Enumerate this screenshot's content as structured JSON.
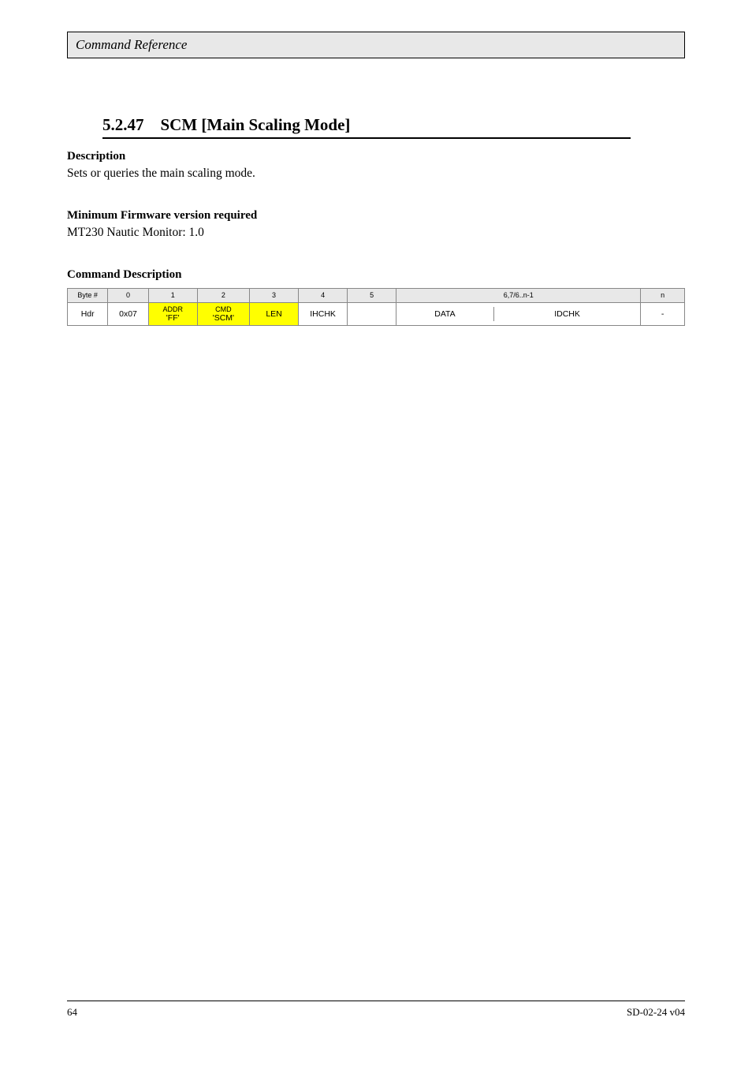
{
  "header": {
    "title": "Command Reference"
  },
  "section": {
    "number": "5.2.47",
    "title": "SCM [Main Scaling Mode]"
  },
  "description": {
    "label": "Description",
    "text": "Sets or queries the main scaling mode."
  },
  "firmware": {
    "label": "Minimum Firmware version required",
    "text": "MT230 Nautic Monitor: 1.0"
  },
  "command_desc": {
    "label": "Command Description"
  },
  "table": {
    "headers": [
      "Byte #",
      "0",
      "1",
      "2",
      "3",
      "4",
      "5",
      "6,7/6..n-1",
      "n"
    ],
    "row": {
      "hdr": "Hdr",
      "attn": "0x07",
      "addr_label": "ADDR",
      "addr_val": "'FF'",
      "cmd_label": "CMD",
      "cmd_val": "'SCM'",
      "len": "LEN",
      "ihchk": "IHCHK",
      "data_cell1": "DATA",
      "data_cell2": "IDCHK",
      "trailer": "-"
    }
  },
  "footer": {
    "page": "64",
    "doc": "SD-02-24 v04"
  }
}
